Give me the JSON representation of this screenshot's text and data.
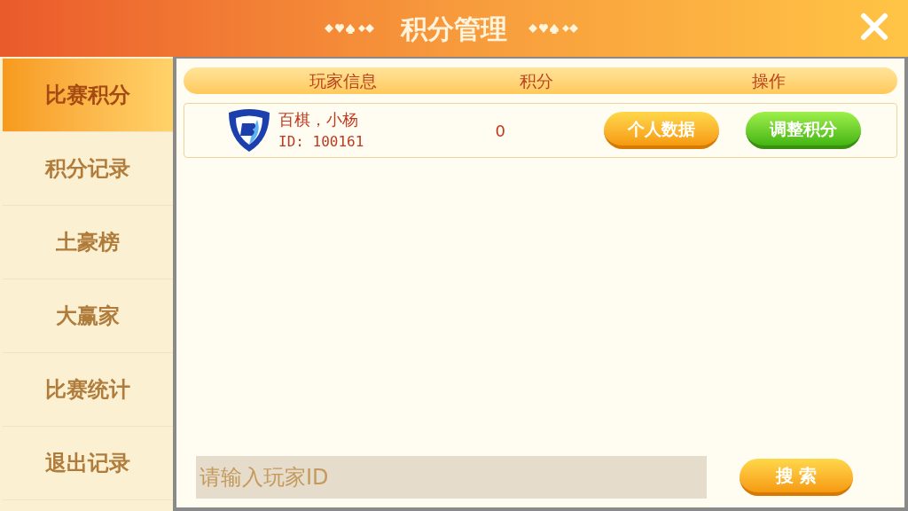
{
  "header": {
    "title": "积分管理"
  },
  "sidebar": {
    "items": [
      {
        "label": "比赛积分",
        "selected": true
      },
      {
        "label": "积分记录",
        "selected": false
      },
      {
        "label": "土豪榜",
        "selected": false
      },
      {
        "label": "大赢家",
        "selected": false
      },
      {
        "label": "比赛统计",
        "selected": false
      },
      {
        "label": "退出记录",
        "selected": false
      }
    ]
  },
  "table": {
    "columns": [
      "玩家信息",
      "积分",
      "操作"
    ],
    "rows": [
      {
        "name": "百棋，小杨",
        "id": "ID: 100161",
        "score": "0",
        "actions": [
          {
            "label": "个人数据",
            "kind": "orange"
          },
          {
            "label": "调整积分",
            "kind": "green"
          }
        ]
      }
    ]
  },
  "search": {
    "placeholder": "请输入玩家ID",
    "button": "搜 索"
  }
}
